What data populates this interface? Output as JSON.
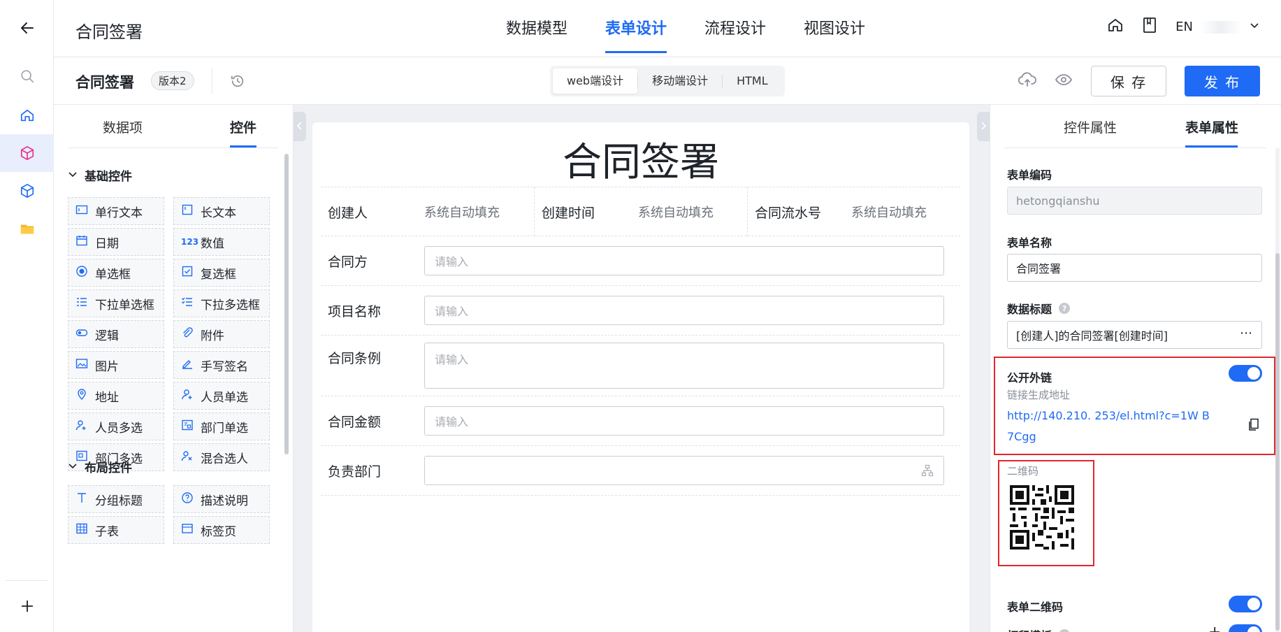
{
  "header": {
    "app_title": "合同签署",
    "tabs": [
      {
        "label": "数据模型"
      },
      {
        "label": "表单设计"
      },
      {
        "label": "流程设计"
      },
      {
        "label": "视图设计"
      }
    ],
    "lang": "EN"
  },
  "toolbar": {
    "form_title": "合同签署",
    "version": "版本2",
    "modes": [
      {
        "label": "web端设计"
      },
      {
        "label": "移动端设计"
      },
      {
        "label": "HTML"
      }
    ],
    "save_label": "保 存",
    "publish_label": "发 布"
  },
  "left_panel": {
    "tabs": [
      {
        "label": "数据项"
      },
      {
        "label": "控件"
      }
    ],
    "groups": [
      {
        "title": "基础控件",
        "items": [
          {
            "label": "单行文本",
            "icon": "single-line-text-icon"
          },
          {
            "label": "长文本",
            "icon": "long-text-icon"
          },
          {
            "label": "日期",
            "icon": "calendar-icon"
          },
          {
            "label": "数值",
            "icon": "number-icon"
          },
          {
            "label": "单选框",
            "icon": "radio-icon"
          },
          {
            "label": "复选框",
            "icon": "checkbox-icon"
          },
          {
            "label": "下拉单选框",
            "icon": "dropdown-single-icon"
          },
          {
            "label": "下拉多选框",
            "icon": "dropdown-multi-icon"
          },
          {
            "label": "逻辑",
            "icon": "toggle-icon"
          },
          {
            "label": "附件",
            "icon": "paperclip-icon"
          },
          {
            "label": "图片",
            "icon": "image-icon"
          },
          {
            "label": "手写签名",
            "icon": "pen-icon"
          },
          {
            "label": "地址",
            "icon": "location-pin-icon"
          },
          {
            "label": "人员单选",
            "icon": "user-single-icon"
          },
          {
            "label": "人员多选",
            "icon": "user-multi-icon"
          },
          {
            "label": "部门单选",
            "icon": "department-single-icon"
          },
          {
            "label": "部门多选",
            "icon": "department-multi-icon"
          },
          {
            "label": "混合选人",
            "icon": "mixed-select-icon"
          }
        ]
      },
      {
        "title": "布局控件",
        "items": [
          {
            "label": "分组标题",
            "icon": "group-title-icon"
          },
          {
            "label": "描述说明",
            "icon": "question-circle-icon"
          },
          {
            "label": "子表",
            "icon": "table-icon"
          },
          {
            "label": "标签页",
            "icon": "tabs-icon"
          }
        ]
      }
    ]
  },
  "canvas": {
    "title": "合同签署",
    "system_fields": [
      {
        "label": "创建人",
        "value": "系统自动填充"
      },
      {
        "label": "创建时间",
        "value": "系统自动填充"
      },
      {
        "label": "合同流水号",
        "value": "系统自动填充"
      }
    ],
    "fields": [
      {
        "label": "合同方",
        "placeholder": "请输入"
      },
      {
        "label": "项目名称",
        "placeholder": "请输入"
      },
      {
        "label": "合同条例",
        "placeholder": "请输入"
      },
      {
        "label": "合同金额",
        "placeholder": "请输入"
      },
      {
        "label": "负责部门",
        "placeholder": ""
      }
    ]
  },
  "right_panel": {
    "tabs": [
      {
        "label": "控件属性"
      },
      {
        "label": "表单属性"
      }
    ],
    "form_code_label": "表单编码",
    "form_code_value": "hetongqianshu",
    "form_name_label": "表单名称",
    "form_name_value": "合同签署",
    "data_title_label": "数据标题",
    "data_title_value": "[创建人]的合同签署[创建时间]",
    "public_link_label": "公开外链",
    "public_link_hint": "链接生成地址",
    "public_link_url": "http://140.210.  253/el.html?c=1W B7Cgg",
    "qr_label": "二维码",
    "form_qr_label": "表单二维码",
    "print_template_label": "打印模板"
  },
  "colors": {
    "primary": "#1f6bf5",
    "highlight_box": "#e0262c"
  }
}
